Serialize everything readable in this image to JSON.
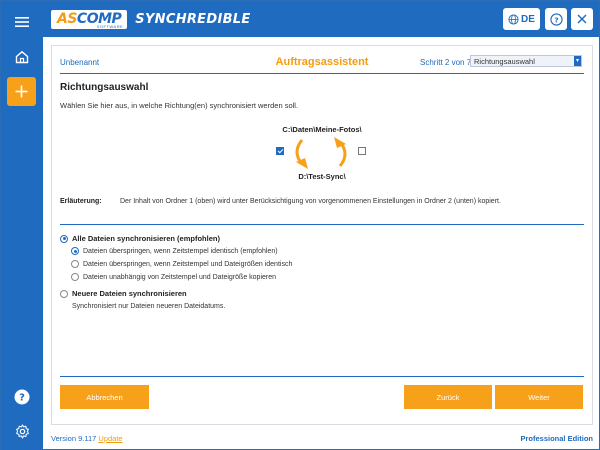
{
  "header": {
    "logo_as": "AS",
    "logo_comp": "COMP",
    "logo_sub": "SOFTWARE",
    "app_name": "SYNCHREDIBLE",
    "language": "DE"
  },
  "sidebar": {
    "items": [
      {
        "icon": "menu-icon"
      },
      {
        "icon": "home-icon"
      },
      {
        "icon": "plus-icon"
      },
      {
        "icon": "help-icon"
      },
      {
        "icon": "gear-icon"
      }
    ]
  },
  "wizard": {
    "job_name": "Unbenannt",
    "title": "Auftragsassistent",
    "step_text": "Schritt 2 von 7:",
    "step_select": "Richtungsauswahl"
  },
  "main": {
    "section_title": "Richtungsauswahl",
    "intro": "Wählen Sie hier aus, in welche Richtung(en) synchronisiert werden soll.",
    "folder1": "C:\\Daten\\Meine-Fotos\\",
    "folder2": "D:\\Test-Sync\\",
    "direction_down_checked": true,
    "direction_up_checked": false,
    "explanation_label": "Erläuterung:",
    "explanation_text": "Der Inhalt von Ordner 1 (oben) wird unter Berücksichtigung von vorgenommenen Einstellungen in Ordner 2 (unten) kopiert."
  },
  "options": {
    "all_files": {
      "label": "Alle Dateien synchronisieren (empfohlen)",
      "selected": true,
      "sub": [
        {
          "label": "Dateien überspringen, wenn Zeitstempel identisch (empfohlen)",
          "selected": true
        },
        {
          "label": "Dateien überspringen, wenn Zeitstempel und Dateigrößen identisch",
          "selected": false
        },
        {
          "label": "Dateien unabhängig von Zeitstempel und Dateigröße kopieren",
          "selected": false
        }
      ]
    },
    "newer_files": {
      "label": "Neuere Dateien synchronisieren",
      "selected": false,
      "description": "Synchronisiert nur Dateien neueren Dateidatums."
    }
  },
  "buttons": {
    "cancel": "Abbrechen",
    "back": "Zurück",
    "next": "Weiter"
  },
  "footer": {
    "version": "Version 9.117",
    "update": "Update",
    "edition": "Professional Edition"
  },
  "colors": {
    "primary": "#1e6bc0",
    "accent": "#f7a11a"
  }
}
